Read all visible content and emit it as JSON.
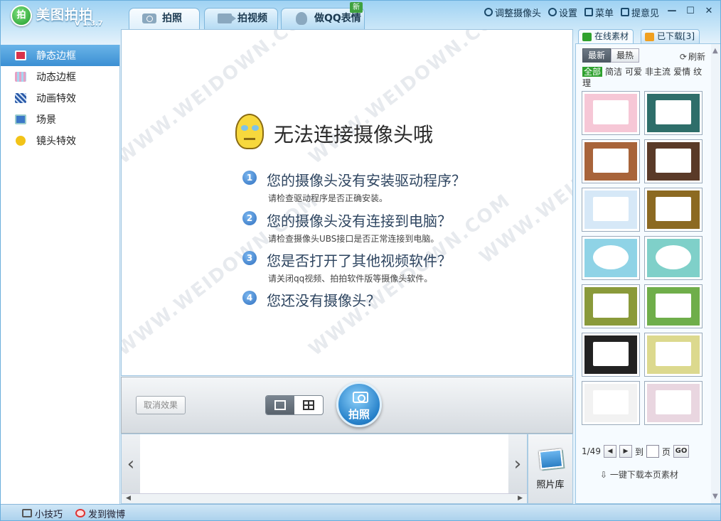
{
  "app": {
    "logo_glyph": "拍",
    "name": "美图拍拍",
    "version": "V 1.3.7"
  },
  "main_tabs": [
    {
      "label": "拍照",
      "icon": "camera-icon",
      "active": true
    },
    {
      "label": "拍视频",
      "icon": "video-camera-icon",
      "active": false
    },
    {
      "label": "做QQ表情",
      "icon": "qq-penguin-icon",
      "active": false,
      "badge": "新"
    }
  ],
  "toolbar": {
    "adjust_camera": "调整摄像头",
    "settings": "设置",
    "menu": "菜单",
    "feedback": "提意见",
    "minimize": "—",
    "maximize": "☐",
    "close": "✕"
  },
  "left_nav": [
    {
      "label": "静态边框",
      "active": true,
      "icon_color": "#d9324a"
    },
    {
      "label": "动态边框",
      "active": false,
      "icon_color": "#e7a0c4"
    },
    {
      "label": "动画特效",
      "active": false,
      "icon_color": "#2b5aa8"
    },
    {
      "label": "场景",
      "active": false,
      "icon_color": "#3c78c8"
    },
    {
      "label": "镜头特效",
      "active": false,
      "icon_color": "#f2c318"
    }
  ],
  "camera_error": {
    "title": "无法连接摄像头哦",
    "issues": [
      {
        "num": "1",
        "question": "您的摄像头没有安装驱动程序？",
        "hint": "请检查驱动程序是否正确安装。"
      },
      {
        "num": "2",
        "question": "您的摄像头没有连接到电脑？",
        "hint": "请检查摄像头UBS接口是否正常连接到电脑。"
      },
      {
        "num": "3",
        "question": "您是否打开了其他视频软件？",
        "hint": "请关闭qq视频、拍拍软件版等摄像头软件。"
      },
      {
        "num": "4",
        "question": "您还没有摄像头？",
        "hint": ""
      }
    ],
    "watermark": "WWW.WEIDOWN.COM"
  },
  "controls": {
    "cancel_effect": "取消效果",
    "layout_single_icon": "single-frame-icon",
    "layout_grid_icon": "grid-frame-icon",
    "shutter_label": "拍照"
  },
  "filmstrip": {
    "prev": "‹",
    "next": "›",
    "scroll_left": "◀",
    "scroll_right": "▶"
  },
  "gallery": {
    "label": "照片库"
  },
  "right_panel": {
    "tabs": [
      {
        "label": "在线素材",
        "active": true,
        "icon_color": "#2fa12f"
      },
      {
        "label": "已下载[3]",
        "active": false,
        "icon_color": "#f0a020"
      }
    ],
    "sort": [
      {
        "label": "最新",
        "active": true
      },
      {
        "label": "最热",
        "active": false
      }
    ],
    "refresh": "刷新",
    "categories": [
      {
        "label": "全部",
        "selected": true
      },
      {
        "label": "简洁",
        "selected": false
      },
      {
        "label": "可爱",
        "selected": false
      },
      {
        "label": "非主流",
        "selected": false
      },
      {
        "label": "爱情",
        "selected": false
      },
      {
        "label": "纹理",
        "selected": false
      }
    ],
    "thumbnails": [
      {
        "bg": "#f6c7d6"
      },
      {
        "bg": "#2e6e6a"
      },
      {
        "bg": "#a8643a"
      },
      {
        "bg": "#5a3a28"
      },
      {
        "bg": "#d6e8f7"
      },
      {
        "bg": "#8c6a22"
      },
      {
        "bg": "#8fd3e6"
      },
      {
        "bg": "#7fd0c9"
      },
      {
        "bg": "#8a9a3a"
      },
      {
        "bg": "#6fae4a"
      },
      {
        "bg": "#222222"
      },
      {
        "bg": "#dcd98e"
      },
      {
        "bg": "#f2f2f2"
      },
      {
        "bg": "#e9d6e0"
      }
    ],
    "pager": {
      "current": "1/49",
      "prev": "◀",
      "next": "▶",
      "to": "到",
      "page": "页",
      "go": "GO"
    },
    "download_all": "一键下载本页素材",
    "scroll_up": "▲",
    "scroll_down": "▼"
  },
  "status_bar": {
    "tips": "小技巧",
    "share_weibo": "发到微博"
  }
}
